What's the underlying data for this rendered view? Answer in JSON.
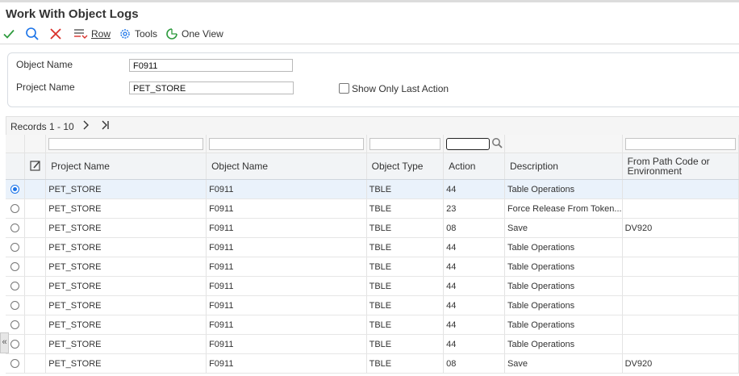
{
  "window": {
    "title": "Work With Object Logs"
  },
  "toolbar": {
    "ok_icon": "check-icon",
    "find_icon": "search-icon",
    "close_icon": "close-icon",
    "row_label": "Row",
    "tools_label": "Tools",
    "oneview_label": "One View"
  },
  "form": {
    "object_name_label": "Object Name",
    "object_name_value": "F0911",
    "project_name_label": "Project Name",
    "project_name_value": "PET_STORE",
    "show_only_last_action_label": "Show Only Last Action",
    "show_only_last_action_checked": false
  },
  "grid": {
    "records_label": "Records 1 - 10",
    "columns": [
      "Project Name",
      "Object Name",
      "Object Type",
      "Action",
      "Description",
      "From Path Code or Environment"
    ],
    "rows": [
      {
        "project": "PET_STORE",
        "object": "F0911",
        "type": "TBLE",
        "action": "44",
        "description": "Table Operations",
        "from_path": ""
      },
      {
        "project": "PET_STORE",
        "object": "F0911",
        "type": "TBLE",
        "action": "23",
        "description": "Force Release From Token...",
        "from_path": ""
      },
      {
        "project": "PET_STORE",
        "object": "F0911",
        "type": "TBLE",
        "action": "08",
        "description": "Save",
        "from_path": "DV920"
      },
      {
        "project": "PET_STORE",
        "object": "F0911",
        "type": "TBLE",
        "action": "44",
        "description": "Table Operations",
        "from_path": ""
      },
      {
        "project": "PET_STORE",
        "object": "F0911",
        "type": "TBLE",
        "action": "44",
        "description": "Table Operations",
        "from_path": ""
      },
      {
        "project": "PET_STORE",
        "object": "F0911",
        "type": "TBLE",
        "action": "44",
        "description": "Table Operations",
        "from_path": ""
      },
      {
        "project": "PET_STORE",
        "object": "F0911",
        "type": "TBLE",
        "action": "44",
        "description": "Table Operations",
        "from_path": ""
      },
      {
        "project": "PET_STORE",
        "object": "F0911",
        "type": "TBLE",
        "action": "44",
        "description": "Table Operations",
        "from_path": ""
      },
      {
        "project": "PET_STORE",
        "object": "F0911",
        "type": "TBLE",
        "action": "44",
        "description": "Table Operations",
        "from_path": ""
      },
      {
        "project": "PET_STORE",
        "object": "F0911",
        "type": "TBLE",
        "action": "08",
        "description": "Save",
        "from_path": "DV920"
      }
    ]
  },
  "colors": {
    "accent": "#1a73e8",
    "ok": "#2e9b3e",
    "cancel": "#d9302a"
  }
}
